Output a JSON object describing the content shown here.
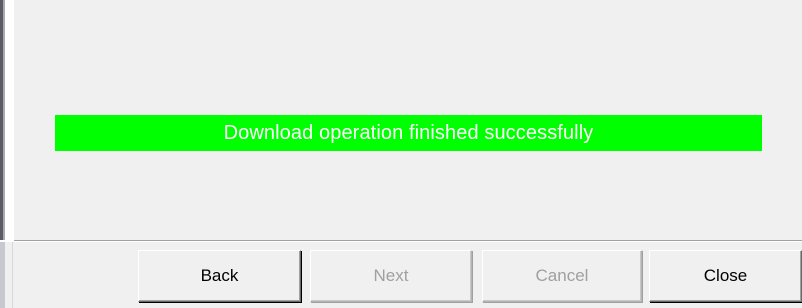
{
  "status": {
    "message": "Download operation finished successfully",
    "background_color": "#00ff00",
    "text_color": "#ffffff"
  },
  "buttons": {
    "back": {
      "label": "Back",
      "enabled": true
    },
    "next": {
      "label": "Next",
      "enabled": false
    },
    "cancel": {
      "label": "Cancel",
      "enabled": false
    },
    "close": {
      "label": "Close",
      "enabled": true
    }
  }
}
